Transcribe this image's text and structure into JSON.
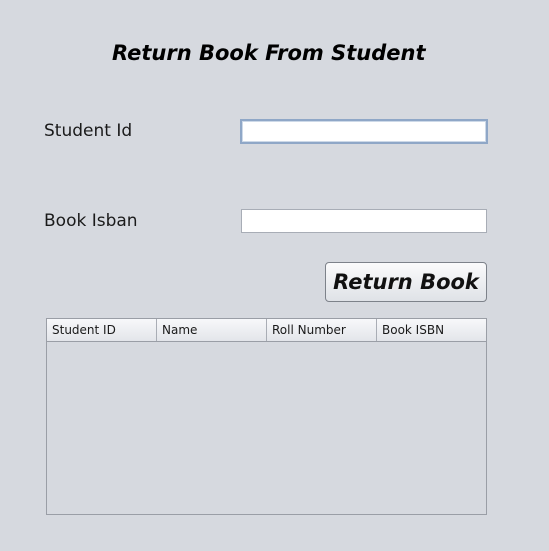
{
  "title": "Return Book From Student",
  "form": {
    "student_id_label": "Student Id",
    "student_id_value": "",
    "book_isbn_label": "Book Isban",
    "book_isbn_value": ""
  },
  "return_button_label": "Return Book",
  "table": {
    "columns": [
      "Student ID",
      "Name",
      "Roll Number",
      "Book ISBN"
    ],
    "rows": []
  }
}
